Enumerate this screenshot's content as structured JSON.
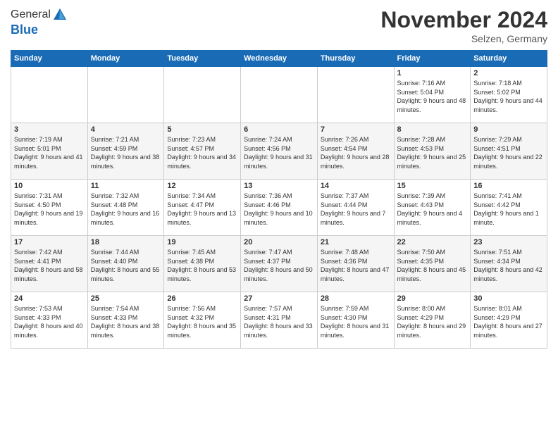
{
  "header": {
    "logo_general": "General",
    "logo_blue": "Blue",
    "month_title": "November 2024",
    "location": "Selzen, Germany"
  },
  "weekdays": [
    "Sunday",
    "Monday",
    "Tuesday",
    "Wednesday",
    "Thursday",
    "Friday",
    "Saturday"
  ],
  "weeks": [
    [
      {
        "day": "",
        "info": ""
      },
      {
        "day": "",
        "info": ""
      },
      {
        "day": "",
        "info": ""
      },
      {
        "day": "",
        "info": ""
      },
      {
        "day": "",
        "info": ""
      },
      {
        "day": "1",
        "info": "Sunrise: 7:16 AM\nSunset: 5:04 PM\nDaylight: 9 hours and 48 minutes."
      },
      {
        "day": "2",
        "info": "Sunrise: 7:18 AM\nSunset: 5:02 PM\nDaylight: 9 hours and 44 minutes."
      }
    ],
    [
      {
        "day": "3",
        "info": "Sunrise: 7:19 AM\nSunset: 5:01 PM\nDaylight: 9 hours and 41 minutes."
      },
      {
        "day": "4",
        "info": "Sunrise: 7:21 AM\nSunset: 4:59 PM\nDaylight: 9 hours and 38 minutes."
      },
      {
        "day": "5",
        "info": "Sunrise: 7:23 AM\nSunset: 4:57 PM\nDaylight: 9 hours and 34 minutes."
      },
      {
        "day": "6",
        "info": "Sunrise: 7:24 AM\nSunset: 4:56 PM\nDaylight: 9 hours and 31 minutes."
      },
      {
        "day": "7",
        "info": "Sunrise: 7:26 AM\nSunset: 4:54 PM\nDaylight: 9 hours and 28 minutes."
      },
      {
        "day": "8",
        "info": "Sunrise: 7:28 AM\nSunset: 4:53 PM\nDaylight: 9 hours and 25 minutes."
      },
      {
        "day": "9",
        "info": "Sunrise: 7:29 AM\nSunset: 4:51 PM\nDaylight: 9 hours and 22 minutes."
      }
    ],
    [
      {
        "day": "10",
        "info": "Sunrise: 7:31 AM\nSunset: 4:50 PM\nDaylight: 9 hours and 19 minutes."
      },
      {
        "day": "11",
        "info": "Sunrise: 7:32 AM\nSunset: 4:48 PM\nDaylight: 9 hours and 16 minutes."
      },
      {
        "day": "12",
        "info": "Sunrise: 7:34 AM\nSunset: 4:47 PM\nDaylight: 9 hours and 13 minutes."
      },
      {
        "day": "13",
        "info": "Sunrise: 7:36 AM\nSunset: 4:46 PM\nDaylight: 9 hours and 10 minutes."
      },
      {
        "day": "14",
        "info": "Sunrise: 7:37 AM\nSunset: 4:44 PM\nDaylight: 9 hours and 7 minutes."
      },
      {
        "day": "15",
        "info": "Sunrise: 7:39 AM\nSunset: 4:43 PM\nDaylight: 9 hours and 4 minutes."
      },
      {
        "day": "16",
        "info": "Sunrise: 7:41 AM\nSunset: 4:42 PM\nDaylight: 9 hours and 1 minute."
      }
    ],
    [
      {
        "day": "17",
        "info": "Sunrise: 7:42 AM\nSunset: 4:41 PM\nDaylight: 8 hours and 58 minutes."
      },
      {
        "day": "18",
        "info": "Sunrise: 7:44 AM\nSunset: 4:40 PM\nDaylight: 8 hours and 55 minutes."
      },
      {
        "day": "19",
        "info": "Sunrise: 7:45 AM\nSunset: 4:38 PM\nDaylight: 8 hours and 53 minutes."
      },
      {
        "day": "20",
        "info": "Sunrise: 7:47 AM\nSunset: 4:37 PM\nDaylight: 8 hours and 50 minutes."
      },
      {
        "day": "21",
        "info": "Sunrise: 7:48 AM\nSunset: 4:36 PM\nDaylight: 8 hours and 47 minutes."
      },
      {
        "day": "22",
        "info": "Sunrise: 7:50 AM\nSunset: 4:35 PM\nDaylight: 8 hours and 45 minutes."
      },
      {
        "day": "23",
        "info": "Sunrise: 7:51 AM\nSunset: 4:34 PM\nDaylight: 8 hours and 42 minutes."
      }
    ],
    [
      {
        "day": "24",
        "info": "Sunrise: 7:53 AM\nSunset: 4:33 PM\nDaylight: 8 hours and 40 minutes."
      },
      {
        "day": "25",
        "info": "Sunrise: 7:54 AM\nSunset: 4:33 PM\nDaylight: 8 hours and 38 minutes."
      },
      {
        "day": "26",
        "info": "Sunrise: 7:56 AM\nSunset: 4:32 PM\nDaylight: 8 hours and 35 minutes."
      },
      {
        "day": "27",
        "info": "Sunrise: 7:57 AM\nSunset: 4:31 PM\nDaylight: 8 hours and 33 minutes."
      },
      {
        "day": "28",
        "info": "Sunrise: 7:59 AM\nSunset: 4:30 PM\nDaylight: 8 hours and 31 minutes."
      },
      {
        "day": "29",
        "info": "Sunrise: 8:00 AM\nSunset: 4:29 PM\nDaylight: 8 hours and 29 minutes."
      },
      {
        "day": "30",
        "info": "Sunrise: 8:01 AM\nSunset: 4:29 PM\nDaylight: 8 hours and 27 minutes."
      }
    ]
  ]
}
